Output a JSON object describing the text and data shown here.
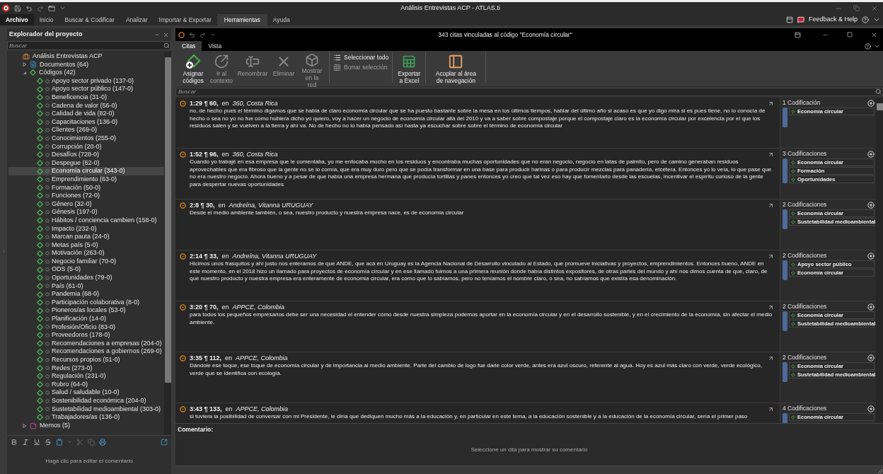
{
  "app_title": "Análisis Entrevistas ACP - ATLAS.ti",
  "menu_tabs": [
    {
      "label": "Archivo",
      "kind": "file",
      "selected": false
    },
    {
      "label": "Inicio",
      "kind": "tab",
      "selected": false
    },
    {
      "label": "Buscar & Codificar",
      "kind": "tab",
      "selected": false
    },
    {
      "label": "Analizar",
      "kind": "tab",
      "selected": false
    },
    {
      "label": "Importar & Exportar",
      "kind": "tab",
      "selected": false
    },
    {
      "label": "Herramientas",
      "kind": "tab",
      "selected": true
    },
    {
      "label": "Ayuda",
      "kind": "tab",
      "selected": false
    }
  ],
  "feedback": "Feedback & Help",
  "explorer": {
    "title": "Explorador del proyecto",
    "search_placeholder": "Buscar",
    "tree": [
      {
        "label": "Análisis Entrevistas ACP",
        "kind": "project",
        "children": [
          {
            "label": "Documentos (64)",
            "kind": "documents",
            "expanded": false
          },
          {
            "label": "Códigos (42)",
            "kind": "codes",
            "expanded": true,
            "children": [
              {
                "label": "Apoyo sector privado (137-0)",
                "selected": false
              },
              {
                "label": "Apoyo sector público (147-0)",
                "selected": false
              },
              {
                "label": "Beneficencia (31-0)",
                "selected": false
              },
              {
                "label": "Cadena de valor (56-0)",
                "selected": false
              },
              {
                "label": "Calidad de vida (82-0)",
                "selected": false
              },
              {
                "label": "Capacitaciones (136-0)",
                "selected": false
              },
              {
                "label": "Clientes (269-0)",
                "selected": false
              },
              {
                "label": "Conocimientos (255-0)",
                "selected": false
              },
              {
                "label": "Corrupción (20-0)",
                "selected": false
              },
              {
                "label": "Desafíos (728-0)",
                "selected": false
              },
              {
                "label": "Despegue (62-0)",
                "selected": false
              },
              {
                "label": "Economía circular (343-0)",
                "selected": true
              },
              {
                "label": "Emprendimiento (63-0)",
                "selected": false
              },
              {
                "label": "Formación (50-0)",
                "selected": false
              },
              {
                "label": "Funciones (72-0)",
                "selected": false
              },
              {
                "label": "Género (32-0)",
                "selected": false
              },
              {
                "label": "Génesis (197-0)",
                "selected": false
              },
              {
                "label": "Hábitos / conciencia cambien (158-0)",
                "selected": false
              },
              {
                "label": "Impacto (232-0)",
                "selected": false
              },
              {
                "label": "Marcan pauta (24-0)",
                "selected": false
              },
              {
                "label": "Metas país (5-0)",
                "selected": false
              },
              {
                "label": "Motivación (263-0)",
                "selected": false
              },
              {
                "label": "Negocio familiar (70-0)",
                "selected": false
              },
              {
                "label": "ODS (5-0)",
                "selected": false
              },
              {
                "label": "Oportunidades (79-0)",
                "selected": false
              },
              {
                "label": "País (61-0)",
                "selected": false
              },
              {
                "label": "Pandemia (68-0)",
                "selected": false
              },
              {
                "label": "Participación colaborativa (8-0)",
                "selected": false
              },
              {
                "label": "Pioneros/as locales (53-0)",
                "selected": false
              },
              {
                "label": "Planificación (14-0)",
                "selected": false
              },
              {
                "label": "Profesión/Oficio (83-0)",
                "selected": false
              },
              {
                "label": "Proveedores (178-0)",
                "selected": false
              },
              {
                "label": "Recomendaciones a empresas (204-0)",
                "selected": false
              },
              {
                "label": "Recomendaciones a gobiernos (269-0)",
                "selected": false
              },
              {
                "label": "Recursos propios (51-0)",
                "selected": false
              },
              {
                "label": "Redes (273-0)",
                "selected": false
              },
              {
                "label": "Regulación (231-0)",
                "selected": false
              },
              {
                "label": "Rubro (64-0)",
                "selected": false
              },
              {
                "label": "Salud / saludable (10-0)",
                "selected": false
              },
              {
                "label": "Sostenibilidad económica (204-0)",
                "selected": false
              },
              {
                "label": "Sustetabilidad medioambiental (303-0)",
                "selected": false
              },
              {
                "label": "Trabajadores/as (136-0)",
                "selected": false
              }
            ]
          },
          {
            "label": "Memos (5)",
            "kind": "memos",
            "expanded": false
          }
        ]
      }
    ],
    "comment_toolbar": [
      {
        "disabled": false
      },
      {
        "disabled": false
      },
      {
        "disabled": false
      },
      {
        "disabled": false
      },
      {
        "disabled": false
      },
      {
        "disabled": false
      },
      {
        "disabled": true
      },
      {
        "disabled": true
      },
      {
        "disabled": false
      }
    ],
    "comment_placeholder": "Haga clic para editar el comentario"
  },
  "quotes_window": {
    "title": "343 citas vinculadas al código \"Economía circular\"",
    "tabs": [
      {
        "label": "Citas",
        "selected": true
      },
      {
        "label": "Vista",
        "selected": false
      }
    ],
    "ribbon": [
      {
        "label": "Asignar códigos",
        "kind": "assign",
        "disabled": false
      },
      {
        "label": "Ir al contexto",
        "kind": "goto",
        "disabled": true
      },
      {
        "label": "Renombrar",
        "kind": "rename",
        "disabled": true
      },
      {
        "label": "Eliminar",
        "kind": "delete",
        "disabled": true
      },
      {
        "label": "Mostrar en la red",
        "kind": "network",
        "disabled": true
      },
      {
        "label": "Seleccionar todo",
        "kind": "select_all",
        "disabled": false
      },
      {
        "label": "Borrar selección",
        "kind": "clear",
        "disabled": true
      },
      {
        "label": "Exportar a Excel",
        "kind": "excel",
        "disabled": false
      },
      {
        "label": "Acoplar al área de navegación",
        "kind": "dock",
        "disabled": false
      }
    ],
    "search_placeholder": "Buscar",
    "quotes": [
      {
        "ref": "1:29 ¶ 60,",
        "in": "en",
        "document": "360, Costa Rica",
        "text": "no, de hecho pues el término digamos que se habla de claro economía circular que se ha puesto bastante sobre la mesa en los últimos tiempos, hablar del último año si acaso es que yo digo mira si es pues tiene, no lo conocía de hecho o sea no yo no fue como hubiera dicho yo quiero, voy a hacer un negocio de economía circular allá del 2010 y va a saber sobre compostaje porque el compostaje claro es la economía circular por excelencia por el que los residuos salen y se vuelven a la tierra y ahí va. No de hecho no lo había pensado así hasta ya escuchar sobre sobre el término de economía circular",
        "codings": "1 Codificación",
        "codes": [
          "Economía circular"
        ]
      },
      {
        "ref": "1:52 ¶ 96,",
        "in": "en",
        "document": "360, Costa Rica",
        "text": "Cuando yo trabajé en esa empresa que le comentaba, yo me enfocaba mucho en los residuos y encontraba muchas oportunidades que no eran negocio, negocio en latas de palmito, pero de camino generaban residuos aprovechables que era fibroso que la gente no se lo comía, que era muy duro pero que se podía transformar en una base para producir harinas o para producir mezclas para panadería, etcétera. Entonces yo lo veía, lo que pase que no era nuestro negocio. Ahora bueno y a pesar de que había una empresa hermana que producía tortillas y panes entonces yo creo que tal vez eso hay que fomentarlo desde las escuelas, incentivar el espíritu curioso de la gente para despertar nuevas oportunidades",
        "codings": "3 Codificaciones",
        "codes": [
          "Economía circular",
          "Formación",
          "Oportunidades"
        ]
      },
      {
        "ref": "2:8 ¶ 30,",
        "in": "en",
        "document": "Andreína, Vitanna URUGUAY",
        "text": "Desde el medio ambiente también, o sea, nuestro producto y nuestra empresa nace, es de economía circular",
        "codings": "2 Codificaciones",
        "codes": [
          "Economía circular",
          "Sustetabilidad medioambiental"
        ]
      },
      {
        "ref": "2:14 ¶ 33,",
        "in": "en",
        "document": "Andreína, Vitanna URUGUAY",
        "text": "Hicimos unos frasquitos y ahí justo nos enteramos de que ANDE, que acá en Uruguay es la Agencia Nacional de Desarrollo vinculado al Estado, que promueve iniciativas y proyectos, emprendimientos. Entonces bueno, ANDE en este momento, en el 2018 hizo un llamado para proyectos de economía circular y en ese llamado fuimos a una primera reunión donde había distintos expositores, de otras partes del mundo y ahí nos dimos cuenta de que, claro, de que nuestro producto y nuestra empresa era enteramente de economía circular, era como que lo sabíamos, pero no teníamos el nombre claro, o sea, no sabíamos que existía esa denominación.",
        "codings": "2 Codificaciones",
        "codes": [
          "Apoyo sector público",
          "Economía circular"
        ]
      },
      {
        "ref": "3:20 ¶ 70,",
        "in": "en",
        "document": "APPCE, Colombia",
        "text": "para todos los pequeños empresarios debe ser una necesidad el entender cómo desde nuestra simpleza podemos aportar en la economía circular y en el desarrollo sostenible, y en el crecimiento de la economía, sin afectar el medio ambiente.",
        "codings": "2 Codificaciones",
        "codes": [
          "Economía circular",
          "Sustetabilidad medioambiental"
        ]
      },
      {
        "ref": "3:35 ¶ 112,",
        "in": "en",
        "document": "APPCE, Colombia",
        "text": "Dándole ese toque, ese toque de economía circular y de importancia al medio ambiente. Parte del cambio de logo fue darle color verde, antes era azul oscuro, referente al agua. Hoy es azul más claro con verde, verde ecológico, verde que se identifica con ecología.",
        "codings": "2 Codificaciones",
        "codes": [
          "Economía circular",
          "Sustetabilidad medioambiental"
        ]
      },
      {
        "ref": "3:43 ¶ 133,",
        "in": "en",
        "document": "APPCE, Colombia",
        "text": "si tuviera la posibilidad de conversar con mi Presidente, le diría que dediquen mucho más a la educación y, en particular en este tema, a la educación sostenible y a la educación de la economía circular, sería el primer paso",
        "codings": "4 Codificaciones",
        "codes": [
          "Economía circular"
        ]
      }
    ],
    "comment_label": "Comentario:",
    "comment_hint": "Seleccione un cita para mostrar su comentario"
  }
}
